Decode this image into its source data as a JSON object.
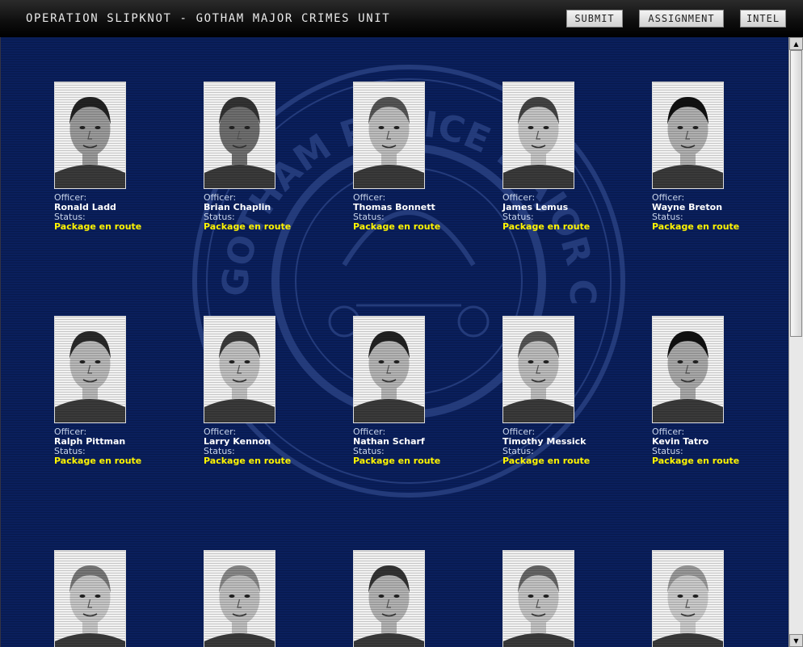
{
  "app": {
    "title": "OPERATION SLIPKNOT - GOTHAM MAJOR CRIMES UNIT",
    "buttons": {
      "submit": "SUBMIT",
      "assignment": "ASSIGNMENT",
      "intel": "INTEL"
    }
  },
  "background": {
    "seal_text": "GOTHAM POLICE MAJOR CRIMES UNIT"
  },
  "labels": {
    "officer": "Officer:",
    "status": "Status:"
  },
  "officers": [
    {
      "name": "Ronald Ladd",
      "status": "Package en route"
    },
    {
      "name": "Brian Chaplin",
      "status": "Package en route"
    },
    {
      "name": "Thomas Bonnett",
      "status": "Package en route"
    },
    {
      "name": "James Lemus",
      "status": "Package en route"
    },
    {
      "name": "Wayne Breton",
      "status": "Package en route"
    },
    {
      "name": "Ralph Pittman",
      "status": "Package en route"
    },
    {
      "name": "Larry Kennon",
      "status": "Package en route"
    },
    {
      "name": "Nathan Scharf",
      "status": "Package en route"
    },
    {
      "name": "Timothy Messick",
      "status": "Package en route"
    },
    {
      "name": "Kevin Tatro",
      "status": "Package en route"
    }
  ],
  "colors": {
    "panel": "#0a1f5c",
    "status": "#fff500",
    "name": "#ffffff",
    "label": "#c8d4ea"
  }
}
